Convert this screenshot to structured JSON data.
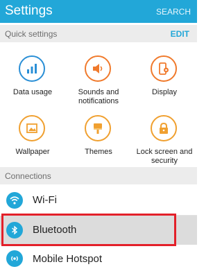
{
  "appbar": {
    "title": "Settings",
    "search_label": "SEARCH"
  },
  "quick": {
    "header": "Quick settings",
    "edit_label": "EDIT",
    "tiles": [
      {
        "label": "Data usage",
        "icon": "bar-chart-icon",
        "color": "#2a8fd6"
      },
      {
        "label": "Sounds and notifications",
        "icon": "speaker-icon",
        "color": "#f07a2c"
      },
      {
        "label": "Display",
        "icon": "phone-settings-icon",
        "color": "#f07a2c"
      },
      {
        "label": "Wallpaper",
        "icon": "image-icon",
        "color": "#f0a030"
      },
      {
        "label": "Themes",
        "icon": "paintbrush-icon",
        "color": "#f0a030"
      },
      {
        "label": "Lock screen and security",
        "icon": "lock-icon",
        "color": "#f0a030"
      }
    ]
  },
  "connections": {
    "header": "Connections",
    "items": [
      {
        "label": "Wi-Fi",
        "icon": "wifi-icon",
        "selected": false
      },
      {
        "label": "Bluetooth",
        "icon": "bluetooth-icon",
        "selected": true
      },
      {
        "label": "Mobile Hotspot",
        "icon": "hotspot-icon",
        "selected": false
      }
    ]
  },
  "colors": {
    "accent": "#22a7d8",
    "highlight": "#e3202a"
  }
}
